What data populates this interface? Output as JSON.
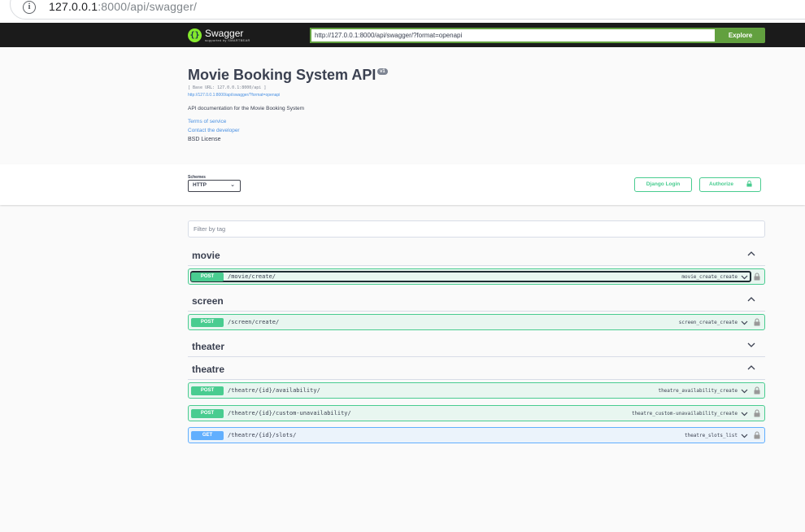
{
  "browser": {
    "url_host": "127.0.0.1",
    "url_rest": ":8000/api/swagger/"
  },
  "topbar": {
    "logo_name": "Swagger",
    "logo_sub": "supported by SMARTBEAR",
    "api_url": "http://127.0.0.1:8000/api/swagger/?format=openapi",
    "explore_label": "Explore"
  },
  "info": {
    "title": "Movie Booking System API",
    "version": "v1",
    "base_url": "[ Base URL: 127.0.0.1:8000/api ]",
    "spec_link": "http://127.0.0.1:8000/api/swagger/?format=openapi",
    "description": "API documentation for the Movie Booking System",
    "terms_label": "Terms of service",
    "contact_label": "Contact the developer",
    "license_label": "BSD License"
  },
  "schemes": {
    "label": "Schemes",
    "selected": "HTTP",
    "django_login_label": "Django Login",
    "authorize_label": "Authorize"
  },
  "filter": {
    "placeholder": "Filter by tag"
  },
  "tags": [
    {
      "name": "movie",
      "expanded": true,
      "operations": [
        {
          "method": "POST",
          "path": "/movie/create/",
          "operation_id": "movie_create_create"
        }
      ]
    },
    {
      "name": "screen",
      "expanded": true,
      "operations": [
        {
          "method": "POST",
          "path": "/screen/create/",
          "operation_id": "screen_create_create"
        }
      ]
    },
    {
      "name": "theater",
      "expanded": false,
      "operations": []
    },
    {
      "name": "theatre",
      "expanded": true,
      "operations": [
        {
          "method": "POST",
          "path": "/theatre/{id}/availability/",
          "operation_id": "theatre_availability_create"
        },
        {
          "method": "POST",
          "path": "/theatre/{id}/custom-unavailability/",
          "operation_id": "theatre_custom-unavailability_create"
        },
        {
          "method": "GET",
          "path": "/theatre/{id}/slots/",
          "operation_id": "theatre_slots_list"
        }
      ]
    }
  ],
  "colors": {
    "post": "#49cc90",
    "get": "#61affe",
    "explore": "#62a03f",
    "topbar": "#1b1b1b"
  }
}
